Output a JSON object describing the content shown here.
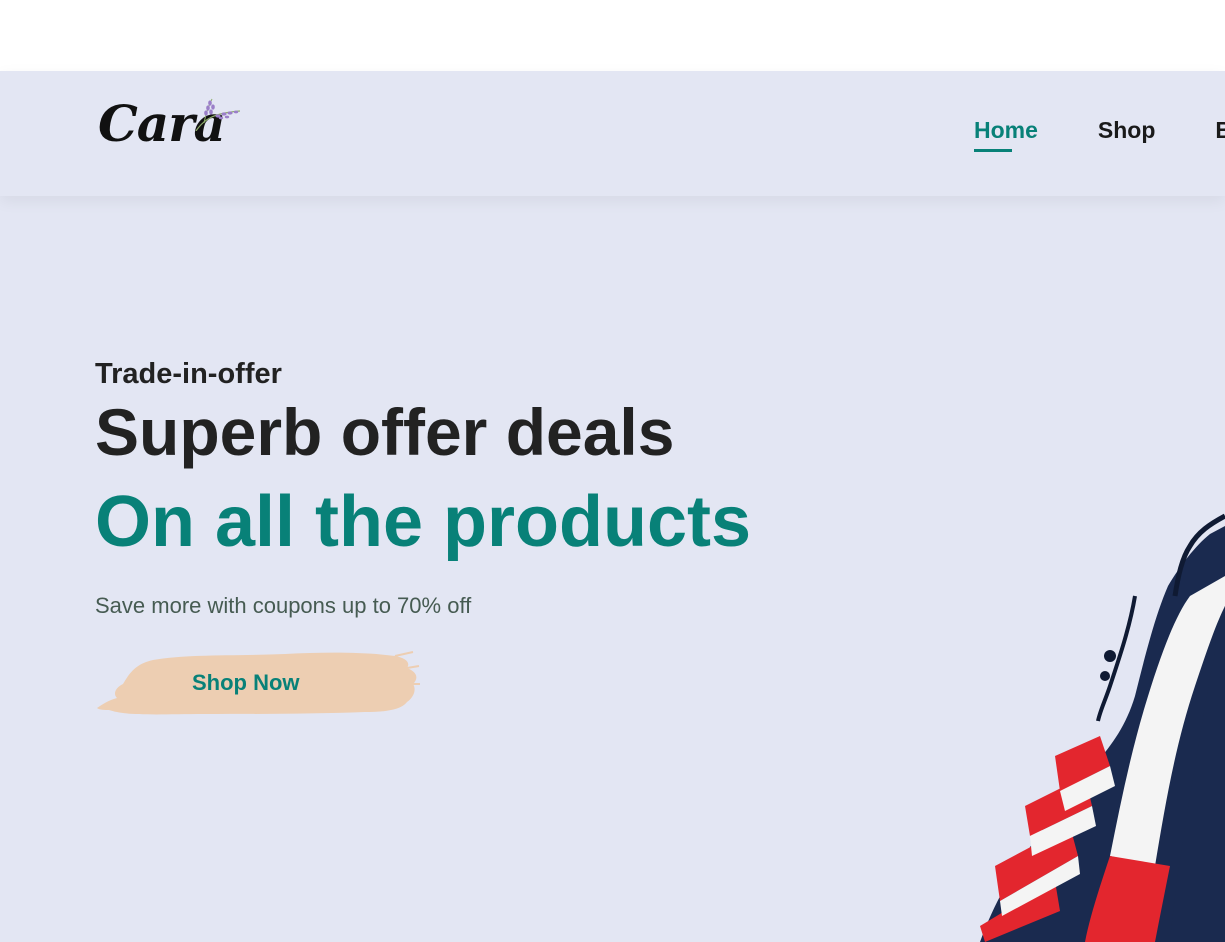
{
  "header": {
    "logo_text": "Cara",
    "nav": [
      {
        "label": "Home",
        "active": true
      },
      {
        "label": "Shop",
        "active": false
      },
      {
        "label": "B",
        "active": false
      }
    ]
  },
  "hero": {
    "subtitle": "Trade-in-offer",
    "title": "Superb offer deals",
    "title_accent": "On all the products",
    "description": "Save more with coupons up to 70% off",
    "cta_label": "Shop Now"
  },
  "colors": {
    "accent": "#088178",
    "background": "#e3e6f3",
    "button_brush": "#edceb2",
    "text_dark": "#222222"
  },
  "icons": {
    "logo_sprig": "lavender-sprig-icon",
    "cta_background": "paint-brush-stroke",
    "hero_product": "jacket-image"
  }
}
